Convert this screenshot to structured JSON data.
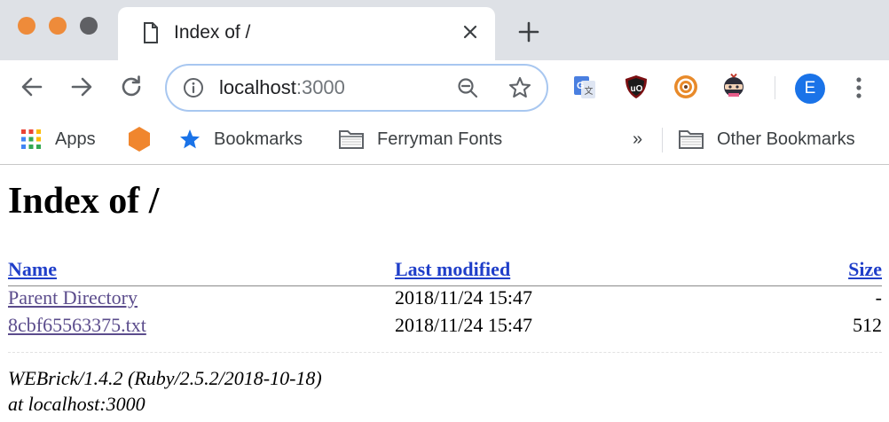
{
  "window": {
    "controls": [
      "close",
      "minimize",
      "maximize"
    ]
  },
  "tab": {
    "title": "Index of /",
    "icon": "document-icon"
  },
  "toolbar": {
    "url_host": "localhost",
    "url_port": ":3000",
    "extensions": [
      "google-translate-icon",
      "ublock-icon",
      "target-icon",
      "ninja-icon"
    ],
    "profile_initial": "E"
  },
  "bookmarks_bar": {
    "items": [
      {
        "label": "Apps",
        "icon": "apps-grid-icon"
      },
      {
        "label": "",
        "icon": "hexagon-icon"
      },
      {
        "label": "Bookmarks",
        "icon": "star-icon"
      },
      {
        "label": "Ferryman Fonts",
        "icon": "folder-icon"
      }
    ],
    "overflow": "»",
    "other": {
      "label": "Other Bookmarks",
      "icon": "folder-icon"
    }
  },
  "page": {
    "title": "Index of /",
    "columns": {
      "name": "Name",
      "modified": "Last modified",
      "size": "Size"
    },
    "rows": [
      {
        "name": "Parent Directory",
        "modified": "2018/11/24 15:47",
        "size": "-"
      },
      {
        "name": "8cbf65563375.txt",
        "modified": "2018/11/24 15:47",
        "size": "512"
      }
    ],
    "server_line1": "WEBrick/1.4.2 (Ruby/2.5.2/2018-10-18)",
    "server_line2": "at localhost:3000"
  },
  "colors": {
    "tabstrip": "#dee1e6",
    "omnibox_focus": "#a8c7f0",
    "link": "#1f3ec9",
    "visited_link": "#5b4c8c",
    "avatar": "#1a73e8"
  }
}
